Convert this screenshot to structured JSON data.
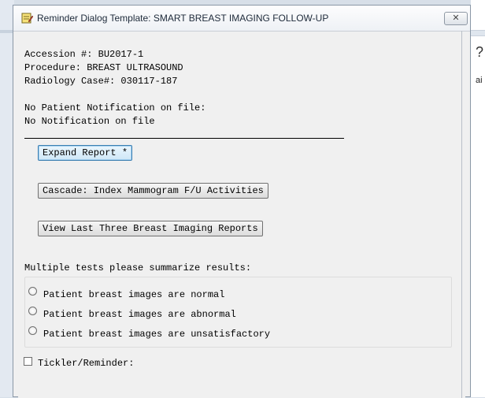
{
  "window": {
    "title": "Reminder Dialog Template: SMART BREAST IMAGING FOLLOW-UP",
    "close_label": "✕"
  },
  "background_app": {
    "glyph": "?",
    "fragment": "ai"
  },
  "info": {
    "accession": "Accession #: BU2017-1",
    "procedure": "Procedure: BREAST ULTRASOUND",
    "case": "Radiology Case#: 030117-187",
    "notification_heading": "No Patient Notification on file:",
    "notification_value": "No Notification on file"
  },
  "buttons": {
    "expand_report": "Expand Report *",
    "cascade": "Cascade: Index Mammogram F/U Activities",
    "view_last_three": "View Last Three Breast Imaging Reports"
  },
  "results": {
    "prompt": "Multiple tests please summarize results:",
    "options": [
      "Patient breast images are normal",
      "Patient breast images are abnormal",
      "Patient breast images are unsatisfactory"
    ]
  },
  "tickler": {
    "label": "Tickler/Reminder:"
  }
}
